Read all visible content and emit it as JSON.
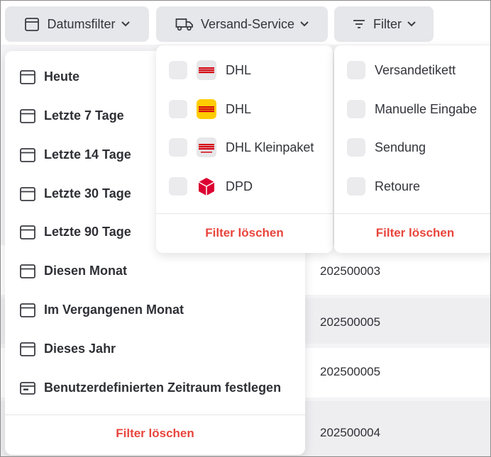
{
  "toolbar": {
    "date_filter_label": "Datumsfilter",
    "shipping_service_label": "Versand-Service",
    "filter_label": "Filter"
  },
  "date_menu": {
    "items": [
      {
        "label": "Heute",
        "icon": "calendar-icon"
      },
      {
        "label": "Letzte 7 Tage",
        "icon": "calendar-icon"
      },
      {
        "label": "Letzte 14 Tage",
        "icon": "calendar-icon"
      },
      {
        "label": "Letzte 30 Tage",
        "icon": "calendar-icon"
      },
      {
        "label": "Letzte 90 Tage",
        "icon": "calendar-icon"
      },
      {
        "label": "Diesen Monat",
        "icon": "calendar-icon"
      },
      {
        "label": "Im Vergangenen Monat",
        "icon": "calendar-icon"
      },
      {
        "label": "Dieses Jahr",
        "icon": "calendar-icon"
      },
      {
        "label": "Benutzerdefinierten Zeitraum festlegen",
        "icon": "calendar-range-icon"
      }
    ],
    "clear_label": "Filter löschen"
  },
  "shipping_menu": {
    "items": [
      {
        "label": "DHL",
        "logo": "dhl-grey-logo",
        "checked": false
      },
      {
        "label": "DHL",
        "logo": "dhl-yellow-logo",
        "checked": false
      },
      {
        "label": "DHL Kleinpaket",
        "logo": "dhl-kleinpaket-logo",
        "checked": false
      },
      {
        "label": "DPD",
        "logo": "dpd-logo",
        "checked": false
      }
    ],
    "clear_label": "Filter löschen"
  },
  "type_menu": {
    "items": [
      {
        "label": "Versandetikett",
        "checked": false
      },
      {
        "label": "Manuelle Eingabe",
        "checked": false
      },
      {
        "label": "Sendung",
        "checked": false
      },
      {
        "label": "Retoure",
        "checked": false
      }
    ],
    "clear_label": "Filter löschen"
  },
  "table": {
    "rows": [
      "202500003",
      "202500005",
      "202500005",
      "202500004"
    ]
  },
  "colors": {
    "accent_red": "#e8453c",
    "button_bg": "#e6e7ea",
    "dhl_yellow": "#ffcc00",
    "dhl_red": "#d40511",
    "dpd_red": "#dc0032"
  }
}
